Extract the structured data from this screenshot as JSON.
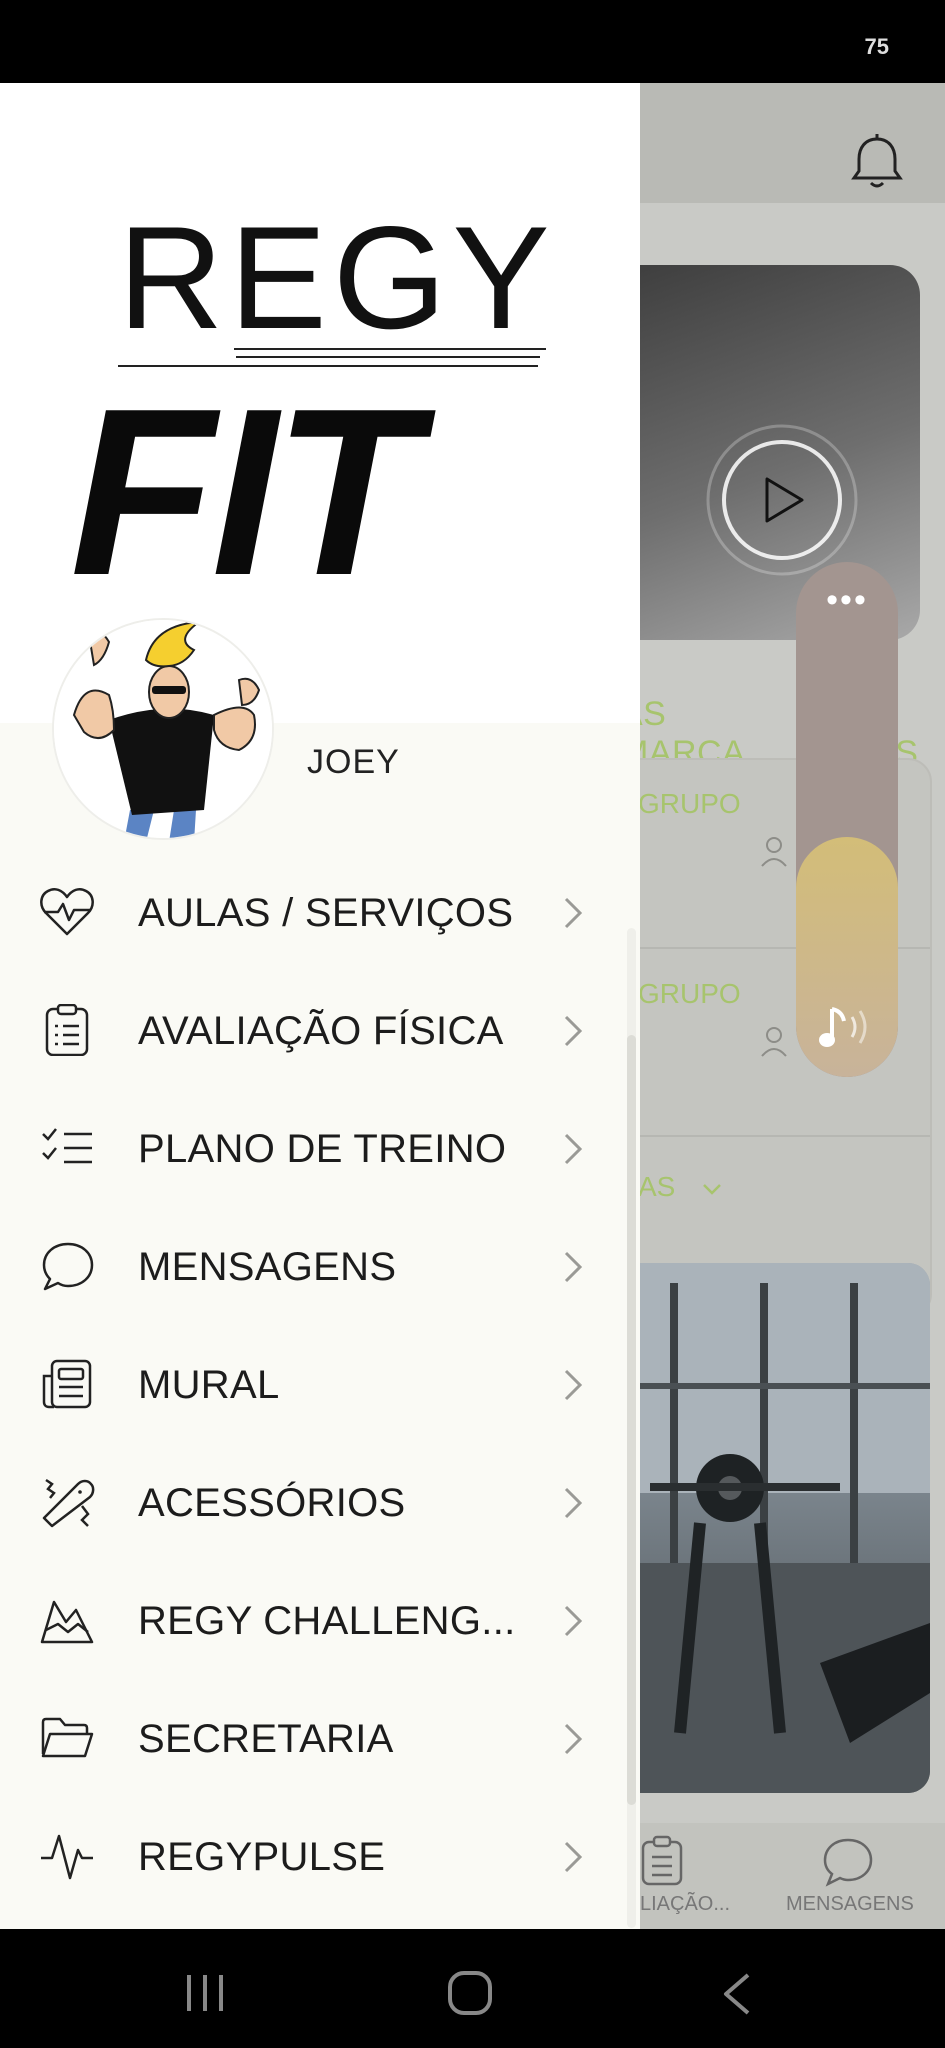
{
  "status_bar": {
    "battery": "75"
  },
  "drawer": {
    "logo": {
      "top": "REGY",
      "bottom": "FIT"
    },
    "user": {
      "name": "JOEY"
    },
    "menu": [
      {
        "label": "AULAS / SERVIÇOS",
        "icon": "heart-pulse-icon"
      },
      {
        "label": "AVALIAÇÃO FÍSICA",
        "icon": "clipboard-icon"
      },
      {
        "label": "PLANO DE TREINO",
        "icon": "checklist-icon"
      },
      {
        "label": "MENSAGENS",
        "icon": "chat-bubble-icon"
      },
      {
        "label": "MURAL",
        "icon": "newspaper-icon"
      },
      {
        "label": "ACESSÓRIOS",
        "icon": "band-aid-icon"
      },
      {
        "label": "REGY CHALLENG...",
        "icon": "mountain-chart-icon"
      },
      {
        "label": "SECRETARIA",
        "icon": "folder-icon"
      },
      {
        "label": "REGYPULSE",
        "icon": "pulse-line-icon"
      }
    ]
  },
  "background": {
    "section_title": "AS MARCA",
    "section_title_tail": "S",
    "groups": [
      {
        "label": "GRUPO"
      },
      {
        "label": "GRUPO"
      }
    ],
    "more_link": "AS",
    "bottom_nav": [
      {
        "label": "LIAÇÃO..."
      },
      {
        "label": "MENSAGENS"
      }
    ]
  },
  "music_widget": {
    "dots": "•••"
  },
  "colors": {
    "accent_green": "#a7c46d",
    "drawer_bg": "#fafaf5",
    "music_widget": "#a39590",
    "music_fill": "#d3bd78"
  }
}
